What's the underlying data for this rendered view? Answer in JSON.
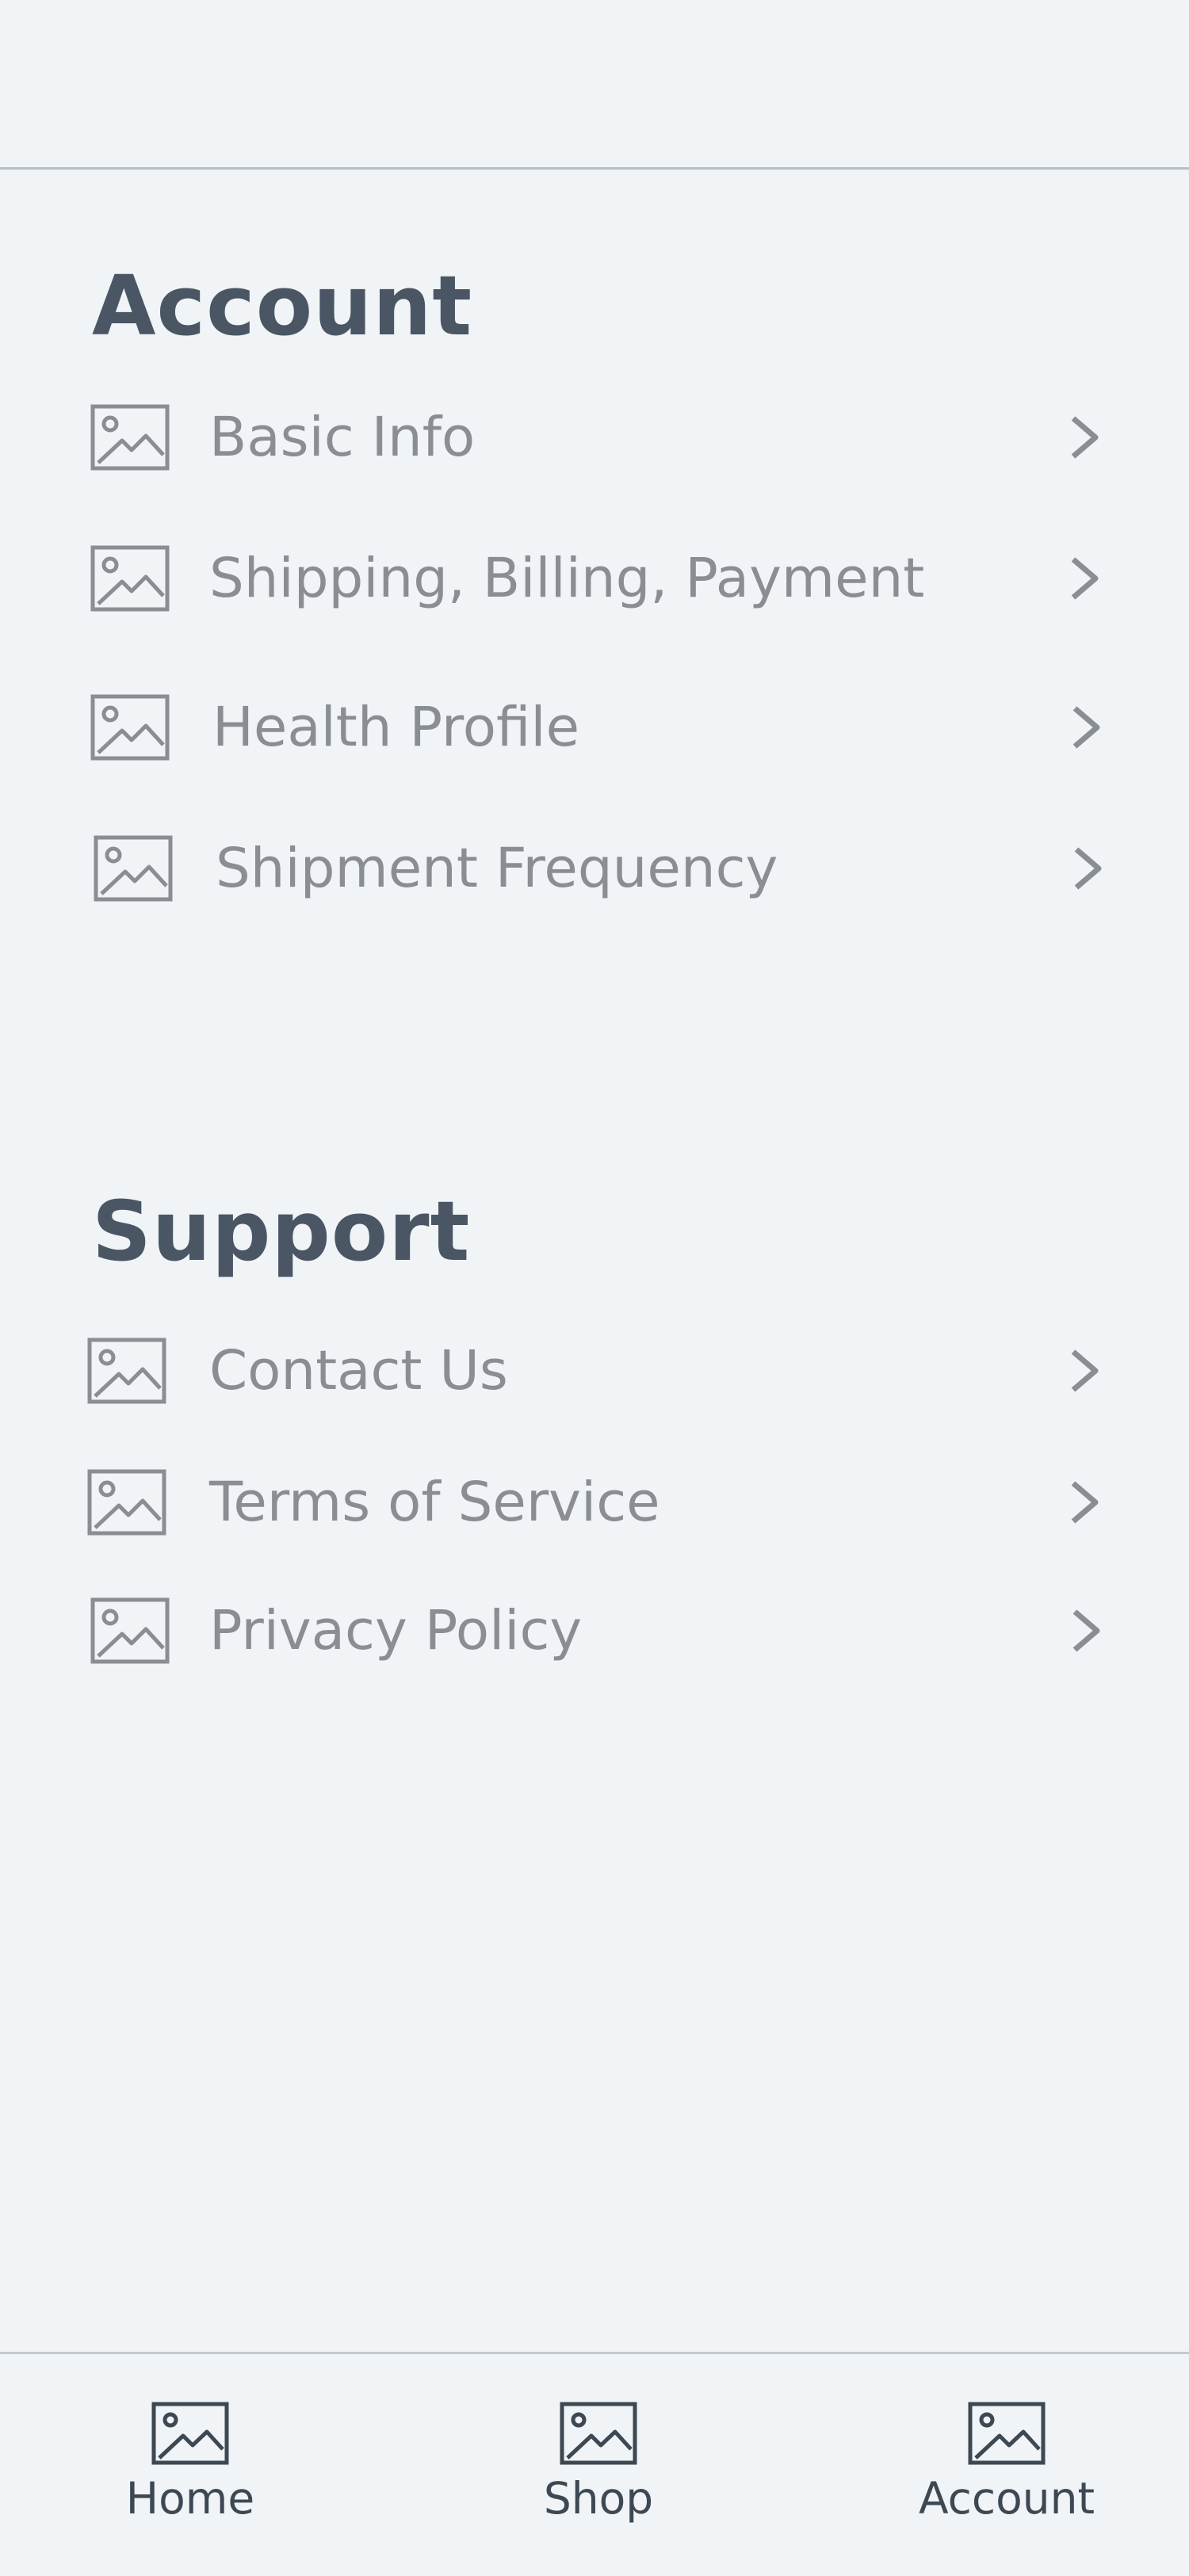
{
  "account": {
    "title": "Account",
    "items": [
      {
        "label": "Basic Info",
        "icon": "image-placeholder-icon"
      },
      {
        "label": "Shipping, Billing, Payment",
        "icon": "image-placeholder-icon"
      },
      {
        "label": "Health Profile",
        "icon": "image-placeholder-icon"
      },
      {
        "label": "Shipment Frequency",
        "icon": "image-placeholder-icon"
      }
    ]
  },
  "support": {
    "title": "Support",
    "items": [
      {
        "label": "Contact Us",
        "icon": "image-placeholder-icon"
      },
      {
        "label": "Terms of Service",
        "icon": "image-placeholder-icon"
      },
      {
        "label": "Privacy Policy",
        "icon": "image-placeholder-icon"
      }
    ]
  },
  "bottom_nav": {
    "items": [
      {
        "label": "Home",
        "icon": "image-placeholder-icon"
      },
      {
        "label": "Shop",
        "icon": "image-placeholder-icon"
      },
      {
        "label": "Account",
        "icon": "image-placeholder-icon"
      }
    ]
  },
  "colors": {
    "background": "#f0f4f7",
    "heading": "#4a5664",
    "row_text": "#8a8e93",
    "nav_text": "#3d4853",
    "divider": "#b9bec4"
  }
}
